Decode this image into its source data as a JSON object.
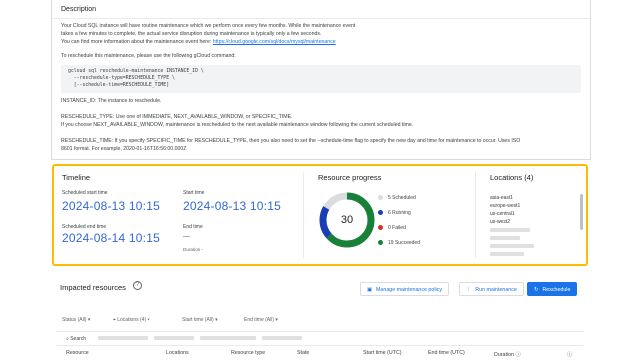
{
  "description": {
    "title": "Description",
    "lines": [
      "Your Cloud SQL instance will have routine maintenance which we perform once every few months. While the maintenance event",
      "takes a few minutes to complete, the actual service disruption during maintenance is typically only a few seconds.",
      "You can find more information about the maintenance event here: "
    ],
    "link_text": "https://cloud.google.com/sql/docs/mysql/maintenance",
    "reschedule_intro": "To reschedule this maintenance, please use the following gCloud command:",
    "code": "gcloud sql reschedule-maintenance INSTANCE_ID \\\n  --reschedule-type=RESCHEDULE_TYPE \\\n  [--schedule-time=RESCHEDULE_TIME]",
    "instance_note": "INSTANCE_ID: The instance to reschedule.",
    "type_note_1": "RESCHEDULE_TYPE: Use one of IMMEDIATE, NEXT_AVAILABLE_WINDOW, or SPECIFIC_TIME.",
    "type_note_2": "If you choose NEXT_AVAILABLE_WINDOW, maintenance is rescheduled to the next available maintenance window following the current scheduled time.",
    "time_note_1": "RESCHEDULE_TIME: If you specify SPECIFIC_TIME for RESCHEDULE_TYPE, then you also need to set the --schedule-time flag to specify the new day and time for maintenance to occur. Uses ISO",
    "time_note_2": "8601 format. For example, 2020-01-16T16:56:00.000Z"
  },
  "timeline": {
    "title": "Timeline",
    "scheduled_start_label": "Scheduled start time",
    "scheduled_start_value": "2024-08-13 10:15",
    "scheduled_end_label": "Scheduled end time",
    "scheduled_end_value": "2024-08-14 10:15",
    "start_label": "Start time",
    "start_value": "2024-08-13 10:15",
    "end_label": "End time",
    "end_value": "—",
    "duration_label": "Duration"
  },
  "progress": {
    "title": "Resource progress",
    "total": "30",
    "items": [
      {
        "label": "5 Scheduled",
        "count": 5,
        "color": "#dadce0"
      },
      {
        "label": "6 Running",
        "count": 6,
        "color": "#1a3fb5"
      },
      {
        "label": "0 Failed",
        "count": 0,
        "color": "#d93025"
      },
      {
        "label": "19 Succeeded",
        "count": 19,
        "color": "#188038"
      }
    ]
  },
  "locations": {
    "title": "Locations (4)",
    "items": [
      "asia-east1",
      "europe-west1",
      "us-central1",
      "us-west2"
    ]
  },
  "impacted": {
    "title": "Impacted resources",
    "help_icon": "help-circle-icon",
    "manage_label": "Manage maintenance policy",
    "run_label": "Run maintenance",
    "reschedule_label": "Reschedule",
    "filters": [
      "Status (All)",
      "Locations (4)",
      "Start time (All)",
      "End time (All)"
    ],
    "search_label": "Search",
    "columns": [
      "Resource",
      "Locations",
      "Resource type",
      "State",
      "Start time (UTC)",
      "End time (UTC)",
      "Duration"
    ]
  }
}
